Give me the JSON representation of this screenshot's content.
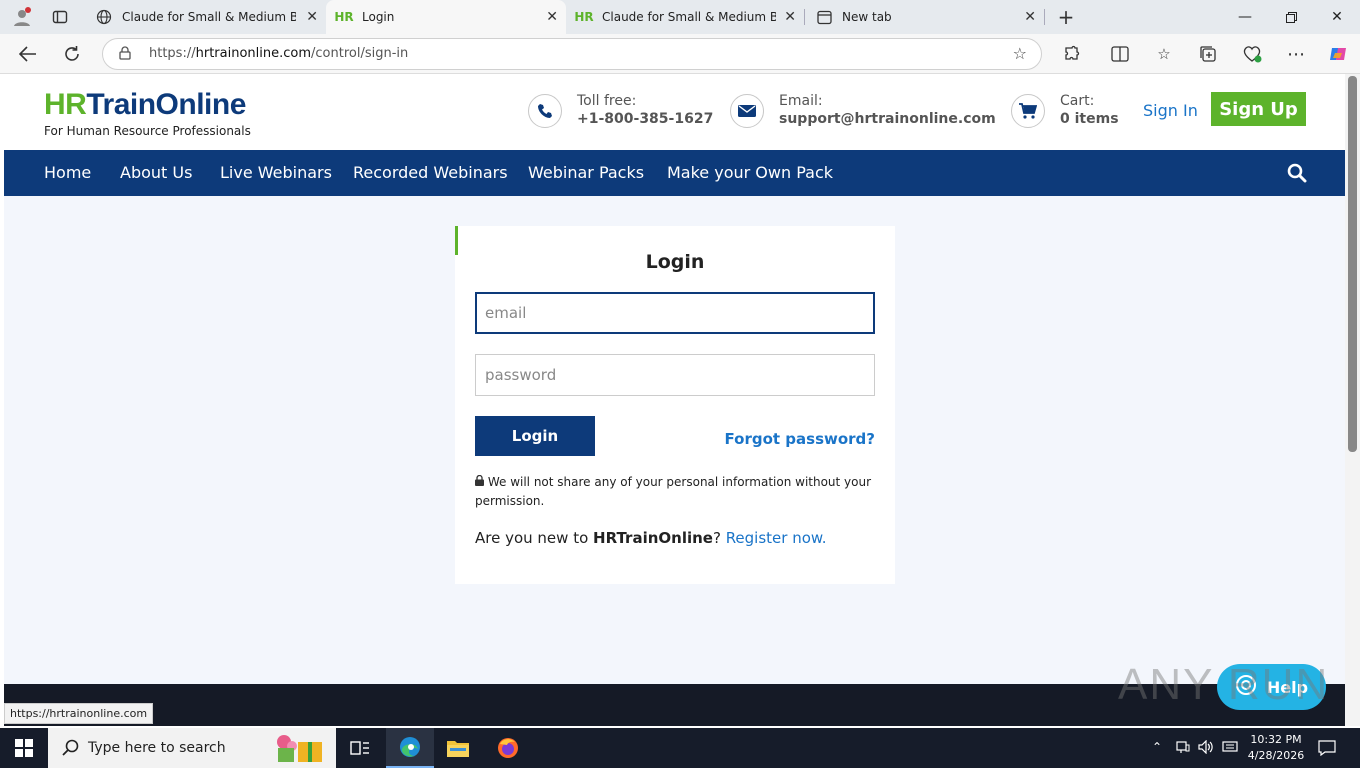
{
  "browser": {
    "tabs": [
      {
        "title": "Claude for Small & Medium Busin",
        "icon": "globe-icon"
      },
      {
        "title": "Login",
        "icon": "hr-favicon"
      },
      {
        "title": "Claude for Small & Medium Busin",
        "icon": "hr-favicon"
      },
      {
        "title": "New tab",
        "icon": "new-tab-icon"
      }
    ],
    "url_prefix": "https://",
    "url_host": "hrtrainonline.com",
    "url_path": "/control/sign-in",
    "status_url": "https://hrtrainonline.com"
  },
  "header": {
    "logo_hr": "HR",
    "logo_rest": "TrainOnline",
    "tagline": "For Human Resource Professionals",
    "toll_label": "Toll free:",
    "toll_value": "+1-800-385-1627",
    "email_label": "Email:",
    "email_value": "support@hrtrainonline.com",
    "cart_label": "Cart:",
    "cart_value": "0 items",
    "sign_in": "Sign In",
    "sign_up": "Sign Up"
  },
  "nav": {
    "items": [
      "Home",
      "About Us",
      "Live Webinars",
      "Recorded Webinars",
      "Webinar Packs",
      "Make your Own Pack"
    ]
  },
  "login": {
    "title": "Login",
    "email_placeholder": "email",
    "password_placeholder": "password",
    "button": "Login",
    "forgot": "Forgot password?",
    "privacy_note": "We will not share any of your personal information without your permission.",
    "register_prefix": "Are you new to ",
    "register_brand": "HRTrainOnline",
    "register_mid": "? ",
    "register_link": "Register now."
  },
  "overlay": {
    "watermark": "ANY RUN",
    "help": "Help"
  },
  "taskbar": {
    "search_placeholder": "Type here to search",
    "time": "10:32 PM",
    "date": "4/28/2026"
  },
  "colors": {
    "brand_navy": "#0d3a7a",
    "brand_green": "#5db32b",
    "link_blue": "#1a74c8"
  }
}
